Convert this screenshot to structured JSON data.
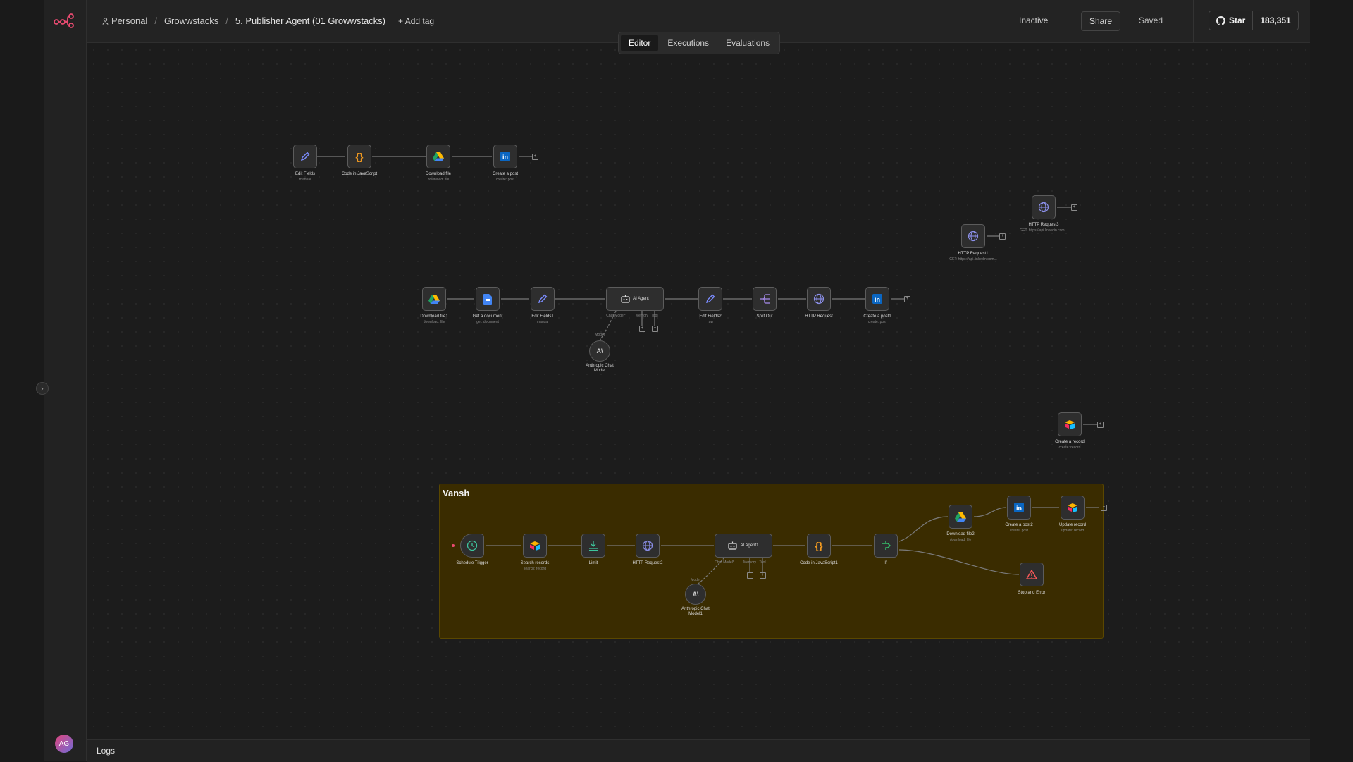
{
  "header": {
    "breadcrumb": {
      "home": "Personal",
      "project": "Growwstacks",
      "workflow": "5. Publisher Agent (01 Growwstacks)"
    },
    "add_tag": "+ Add tag",
    "status": "Inactive",
    "share": "Share",
    "saved": "Saved",
    "github": {
      "star": "Star",
      "count": "183,351"
    }
  },
  "tabs": [
    "Editor",
    "Executions",
    "Evaluations"
  ],
  "active_tab": "Editor",
  "sidebar": {
    "avatar": "AG"
  },
  "logs": "Logs",
  "sticky": {
    "title": "Vansh"
  },
  "nodes": {
    "edit_fields": {
      "label": "Edit Fields",
      "sub": "manual"
    },
    "code_js": {
      "label": "Code in JavaScript"
    },
    "download_file": {
      "label": "Download file",
      "sub": "download: file"
    },
    "create_post": {
      "label": "Create a post",
      "sub": "create: post"
    },
    "http_request3": {
      "label": "HTTP Request3",
      "sub": "GET: https://api.linkedin.com..."
    },
    "http_request1": {
      "label": "HTTP Request1",
      "sub": "GET: https://api.linkedin.com..."
    },
    "download_file1": {
      "label": "Download file1",
      "sub": "download: file"
    },
    "get_document": {
      "label": "Get a document",
      "sub": "get: document"
    },
    "edit_fields1": {
      "label": "Edit Fields1",
      "sub": "manual"
    },
    "ai_agent": {
      "label": "AI Agent",
      "ports": [
        "Chat Model*",
        "Memory",
        "Tool"
      ]
    },
    "edit_fields2": {
      "label": "Edit Fields2",
      "sub": "raw"
    },
    "split_out": {
      "label": "Split Out"
    },
    "http_request": {
      "label": "HTTP Request"
    },
    "create_post1": {
      "label": "Create a post1",
      "sub": "create: post"
    },
    "anthropic": {
      "label": "Anthropic Chat Model",
      "port": "Model"
    },
    "create_record": {
      "label": "Create a record",
      "sub": "create: record"
    },
    "schedule": {
      "label": "Schedule Trigger"
    },
    "search_records": {
      "label": "Search records",
      "sub": "search: record"
    },
    "limit": {
      "label": "Limit"
    },
    "http_request2": {
      "label": "HTTP Request2"
    },
    "ai_agent1": {
      "label": "AI Agent1",
      "ports": [
        "Chat Model*",
        "Memory",
        "Tool"
      ]
    },
    "code_js1": {
      "label": "Code in JavaScript1"
    },
    "if": {
      "label": "If"
    },
    "download_file2": {
      "label": "Download file2",
      "sub": "download: file"
    },
    "create_post2": {
      "label": "Create a post2",
      "sub": "create: post"
    },
    "update_record": {
      "label": "Update record",
      "sub": "update: record"
    },
    "stop_error": {
      "label": "Stop and Error"
    },
    "anthropic1": {
      "label": "Anthropic Chat Model1",
      "port": "Model"
    }
  },
  "colors": {
    "accent": "#ea4b71",
    "sticky": "#3a2c00",
    "linkedin": "#0a66c2",
    "edit": "#7b8cff",
    "code": "#f29a1f",
    "gdrive_green": "#1fa463",
    "gdocs": "#4285f4",
    "http": "#8b8fe8",
    "split": "#a98df0",
    "schedule": "#3ec59d",
    "limit": "#3ec59d",
    "if": "#36c06a",
    "error": "#ff5a5a"
  }
}
